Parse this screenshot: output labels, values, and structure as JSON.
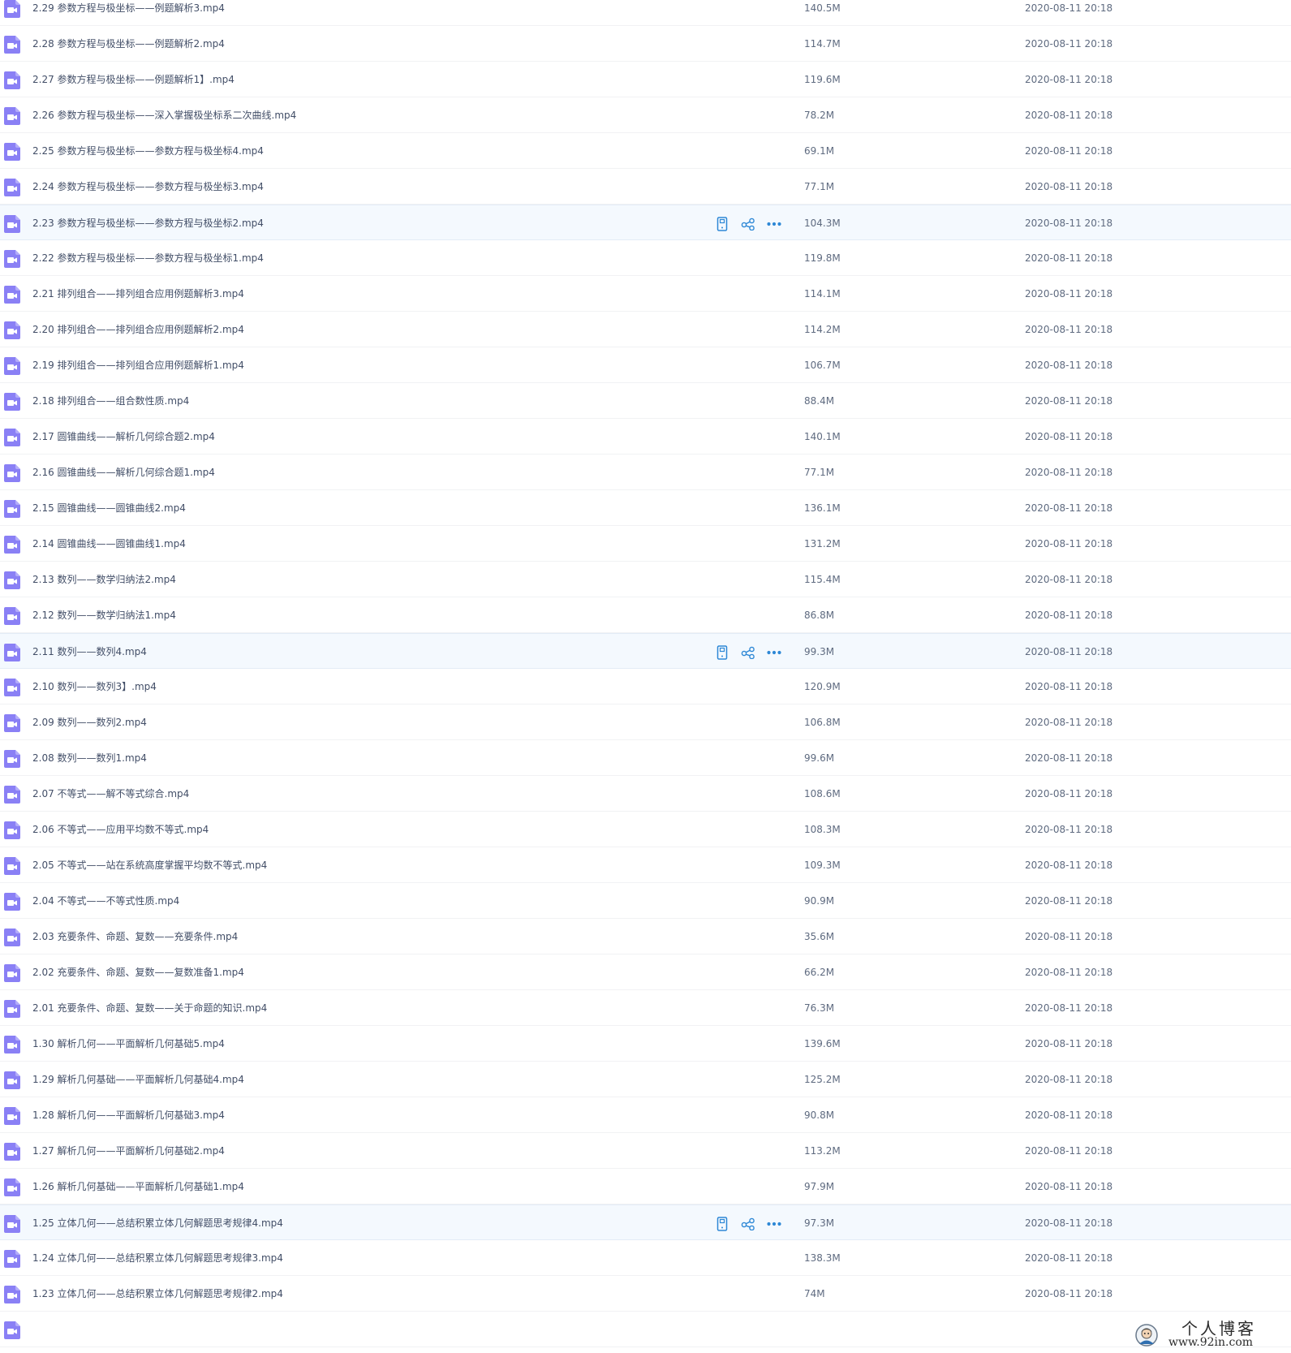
{
  "colors": {
    "video_icon": "#8a80f5",
    "action_icon": "#2e88d6",
    "hover_bg": "#f4f9fe"
  },
  "icons": {
    "file": "video-file-icon",
    "actions": [
      "phone-icon",
      "share-icon",
      "more-icon"
    ]
  },
  "files": [
    {
      "name": "2.29 参数方程与极坐标——例题解析3.mp4",
      "size": "140.5M",
      "date": "2020-08-11 20:18"
    },
    {
      "name": "2.28 参数方程与极坐标——例题解析2.mp4",
      "size": "114.7M",
      "date": "2020-08-11 20:18"
    },
    {
      "name": "2.27 参数方程与极坐标——例题解析1】.mp4",
      "size": "119.6M",
      "date": "2020-08-11 20:18"
    },
    {
      "name": "2.26 参数方程与极坐标——深入掌握极坐标系二次曲线.mp4",
      "size": "78.2M",
      "date": "2020-08-11 20:18"
    },
    {
      "name": "2.25 参数方程与极坐标——参数方程与极坐标4.mp4",
      "size": "69.1M",
      "date": "2020-08-11 20:18"
    },
    {
      "name": "2.24 参数方程与极坐标——参数方程与极坐标3.mp4",
      "size": "77.1M",
      "date": "2020-08-11 20:18"
    },
    {
      "name": "2.23 参数方程与极坐标——参数方程与极坐标2.mp4",
      "size": "104.3M",
      "date": "2020-08-11 20:18",
      "hovered": true
    },
    {
      "name": "2.22 参数方程与极坐标——参数方程与极坐标1.mp4",
      "size": "119.8M",
      "date": "2020-08-11 20:18"
    },
    {
      "name": "2.21 排列组合——排列组合应用例题解析3.mp4",
      "size": "114.1M",
      "date": "2020-08-11 20:18"
    },
    {
      "name": "2.20 排列组合——排列组合应用例题解析2.mp4",
      "size": "114.2M",
      "date": "2020-08-11 20:18"
    },
    {
      "name": "2.19 排列组合——排列组合应用例题解析1.mp4",
      "size": "106.7M",
      "date": "2020-08-11 20:18"
    },
    {
      "name": "2.18 排列组合——组合数性质.mp4",
      "size": "88.4M",
      "date": "2020-08-11 20:18"
    },
    {
      "name": "2.17 圆锥曲线——解析几何综合题2.mp4",
      "size": "140.1M",
      "date": "2020-08-11 20:18"
    },
    {
      "name": "2.16 圆锥曲线——解析几何综合题1.mp4",
      "size": "77.1M",
      "date": "2020-08-11 20:18"
    },
    {
      "name": "2.15 圆锥曲线——圆锥曲线2.mp4",
      "size": "136.1M",
      "date": "2020-08-11 20:18"
    },
    {
      "name": "2.14 圆锥曲线——圆锥曲线1.mp4",
      "size": "131.2M",
      "date": "2020-08-11 20:18"
    },
    {
      "name": "2.13 数列——数学归纳法2.mp4",
      "size": "115.4M",
      "date": "2020-08-11 20:18"
    },
    {
      "name": "2.12 数列——数学归纳法1.mp4",
      "size": "86.8M",
      "date": "2020-08-11 20:18"
    },
    {
      "name": "2.11 数列——数列4.mp4",
      "size": "99.3M",
      "date": "2020-08-11 20:18",
      "hovered": true
    },
    {
      "name": "2.10 数列——数列3】.mp4",
      "size": "120.9M",
      "date": "2020-08-11 20:18"
    },
    {
      "name": "2.09 数列——数列2.mp4",
      "size": "106.8M",
      "date": "2020-08-11 20:18"
    },
    {
      "name": "2.08 数列——数列1.mp4",
      "size": "99.6M",
      "date": "2020-08-11 20:18"
    },
    {
      "name": "2.07 不等式——解不等式综合.mp4",
      "size": "108.6M",
      "date": "2020-08-11 20:18"
    },
    {
      "name": "2.06 不等式——应用平均数不等式.mp4",
      "size": "108.3M",
      "date": "2020-08-11 20:18"
    },
    {
      "name": "2.05 不等式——站在系统高度掌握平均数不等式.mp4",
      "size": "109.3M",
      "date": "2020-08-11 20:18"
    },
    {
      "name": "2.04 不等式——不等式性质.mp4",
      "size": "90.9M",
      "date": "2020-08-11 20:18"
    },
    {
      "name": "2.03 充要条件、命题、复数——充要条件.mp4",
      "size": "35.6M",
      "date": "2020-08-11 20:18"
    },
    {
      "name": "2.02 充要条件、命题、复数——复数准备1.mp4",
      "size": "66.2M",
      "date": "2020-08-11 20:18"
    },
    {
      "name": "2.01 充要条件、命题、复数——关于命题的知识.mp4",
      "size": "76.3M",
      "date": "2020-08-11 20:18"
    },
    {
      "name": "1.30 解析几何——平面解析几何基础5.mp4",
      "size": "139.6M",
      "date": "2020-08-11 20:18"
    },
    {
      "name": "1.29 解析几何基础——平面解析几何基础4.mp4",
      "size": "125.2M",
      "date": "2020-08-11 20:18"
    },
    {
      "name": "1.28 解析几何——平面解析几何基础3.mp4",
      "size": "90.8M",
      "date": "2020-08-11 20:18"
    },
    {
      "name": "1.27 解析几何——平面解析几何基础2.mp4",
      "size": "113.2M",
      "date": "2020-08-11 20:18"
    },
    {
      "name": "1.26 解析几何基础——平面解析几何基础1.mp4",
      "size": "97.9M",
      "date": "2020-08-11 20:18"
    },
    {
      "name": "1.25 立体几何——总结积累立体几何解题思考规律4.mp4",
      "size": "97.3M",
      "date": "2020-08-11 20:18",
      "hovered": true
    },
    {
      "name": "1.24 立体几何——总结积累立体几何解题思考规律3.mp4",
      "size": "138.3M",
      "date": "2020-08-11 20:18"
    },
    {
      "name": "1.23 立体几何——总结积累立体几何解题思考规律2.mp4",
      "size": "74M",
      "date": "2020-08-11 20:18"
    },
    {
      "name": "",
      "size": "",
      "date": ""
    }
  ],
  "watermark": {
    "title": "个人博客",
    "url": "www.92in.com"
  }
}
